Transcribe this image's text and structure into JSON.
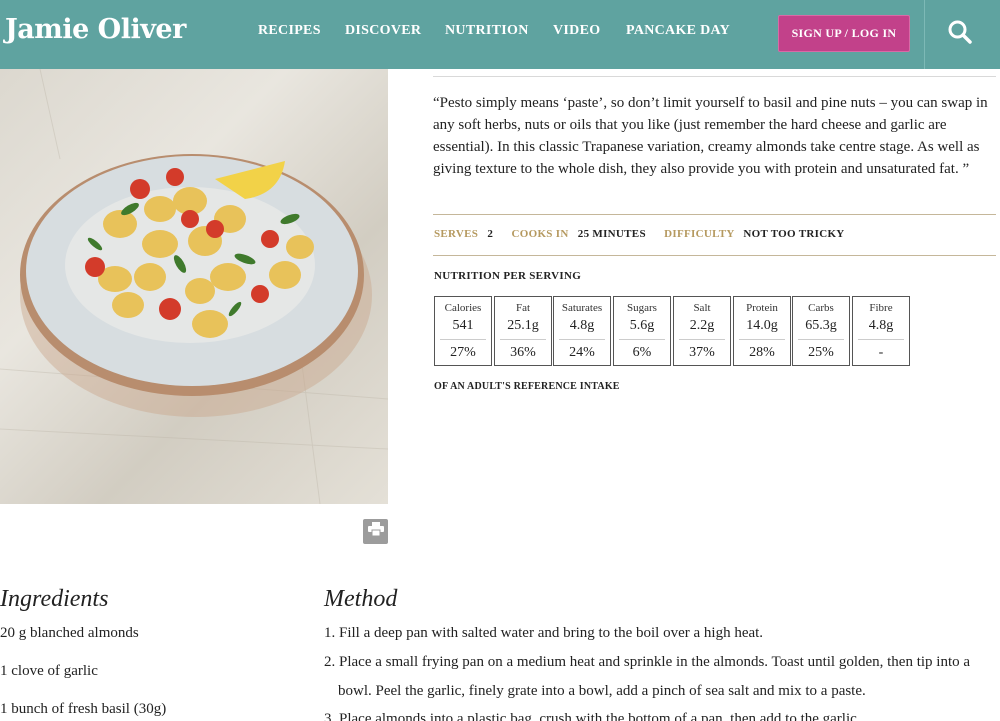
{
  "header": {
    "logo": "Jamie Oliver",
    "nav": [
      "RECIPES",
      "DISCOVER",
      "NUTRITION",
      "VIDEO",
      "PANCAKE DAY"
    ],
    "signup_label": "SIGN UP / LOG IN",
    "search_icon": "search-icon"
  },
  "colors": {
    "header_bg": "#5fa3a0",
    "signup_bg": "#c2418a",
    "meta_label": "#b5995f"
  },
  "recipe": {
    "intro": "“Pesto simply means ‘paste’, so don’t limit yourself to basil and pine nuts – you can swap in any soft herbs, nuts or oils that you like (just remember the hard cheese and garlic are essential). In this classic Trapanese variation, creamy almonds take centre stage. As well as giving texture to the whole dish, they also provide you with protein and unsaturated fat. ”",
    "serves_label": "SERVES",
    "serves_value": "2",
    "cooks_label": "COOKS IN",
    "cooks_value": "25 MINUTES",
    "difficulty_label": "DIFFICULTY",
    "difficulty_value": "NOT TOO TRICKY",
    "print_icon": "print-icon"
  },
  "nutrition": {
    "title": "NUTRITION PER SERVING",
    "items": [
      {
        "label": "Calories",
        "value": "541",
        "percent": "27%"
      },
      {
        "label": "Fat",
        "value": "25.1g",
        "percent": "36%"
      },
      {
        "label": "Saturates",
        "value": "4.8g",
        "percent": "24%"
      },
      {
        "label": "Sugars",
        "value": "5.6g",
        "percent": "6%"
      },
      {
        "label": "Salt",
        "value": "2.2g",
        "percent": "37%"
      },
      {
        "label": "Protein",
        "value": "14.0g",
        "percent": "28%"
      },
      {
        "label": "Carbs",
        "value": "65.3g",
        "percent": "25%"
      },
      {
        "label": "Fibre",
        "value": "4.8g",
        "percent": "-"
      }
    ],
    "reference": "OF AN ADULT'S REFERENCE INTAKE"
  },
  "ingredients": {
    "title": "Ingredients",
    "items": [
      "20 g blanched almonds",
      "1 clove of garlic",
      "1 bunch of fresh basil (30g)"
    ]
  },
  "method": {
    "title": "Method",
    "lines": [
      "1. Fill a deep pan with salted water and bring to the boil over a high heat.",
      "2. Place a small frying pan on a medium heat and sprinkle in the almonds. Toast until golden, then tip into a",
      "bowl. Peel the garlic, finely grate into a bowl, add a pinch of sea salt and mix to a paste.",
      "3. Place almonds into a plastic bag, crush with the bottom of a pan, then add to the garlic."
    ]
  }
}
